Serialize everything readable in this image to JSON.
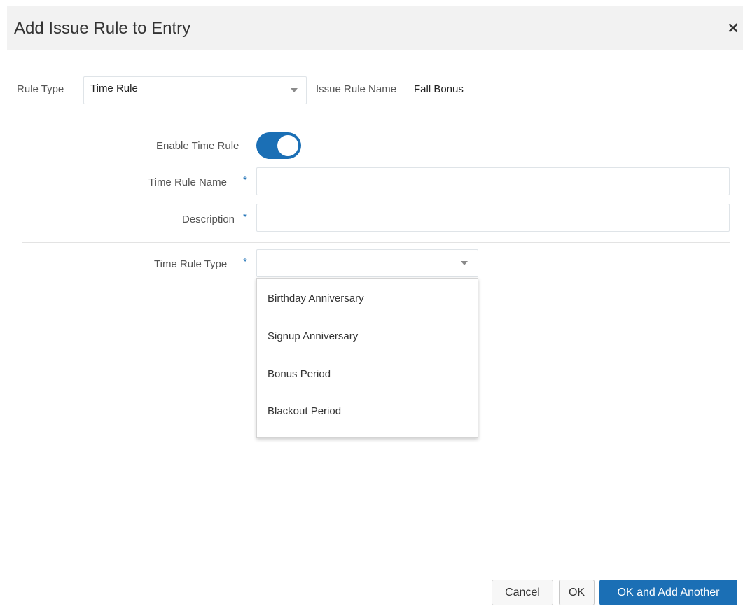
{
  "dialog": {
    "title": "Add Issue Rule to Entry",
    "close_icon": "close-icon"
  },
  "rule_type": {
    "label": "Rule Type",
    "value": "Time Rule",
    "caret_icon": "caret-down-icon"
  },
  "issue_rule_name": {
    "label": "Issue Rule Name",
    "value": "Fall Bonus"
  },
  "enable_time_rule": {
    "label": "Enable Time Rule",
    "enabled": true
  },
  "time_rule_name": {
    "label": "Time Rule Name",
    "required_mark": "*",
    "value": "",
    "placeholder": ""
  },
  "description": {
    "label": "Description",
    "required_mark": "*",
    "value": "",
    "placeholder": ""
  },
  "time_rule_type": {
    "label": "Time Rule Type",
    "required_mark": "*",
    "value": "",
    "caret_icon": "caret-down-icon",
    "options": [
      "Birthday Anniversary",
      "Signup Anniversary",
      "Bonus Period",
      "Blackout Period"
    ]
  },
  "footer": {
    "cancel_label": "Cancel",
    "ok_label": "OK",
    "ok_add_another_label": "OK and Add Another"
  },
  "colors": {
    "accent": "#1b6fb5",
    "header_bg": "#f2f2f2",
    "required": "#1b6fb5"
  }
}
